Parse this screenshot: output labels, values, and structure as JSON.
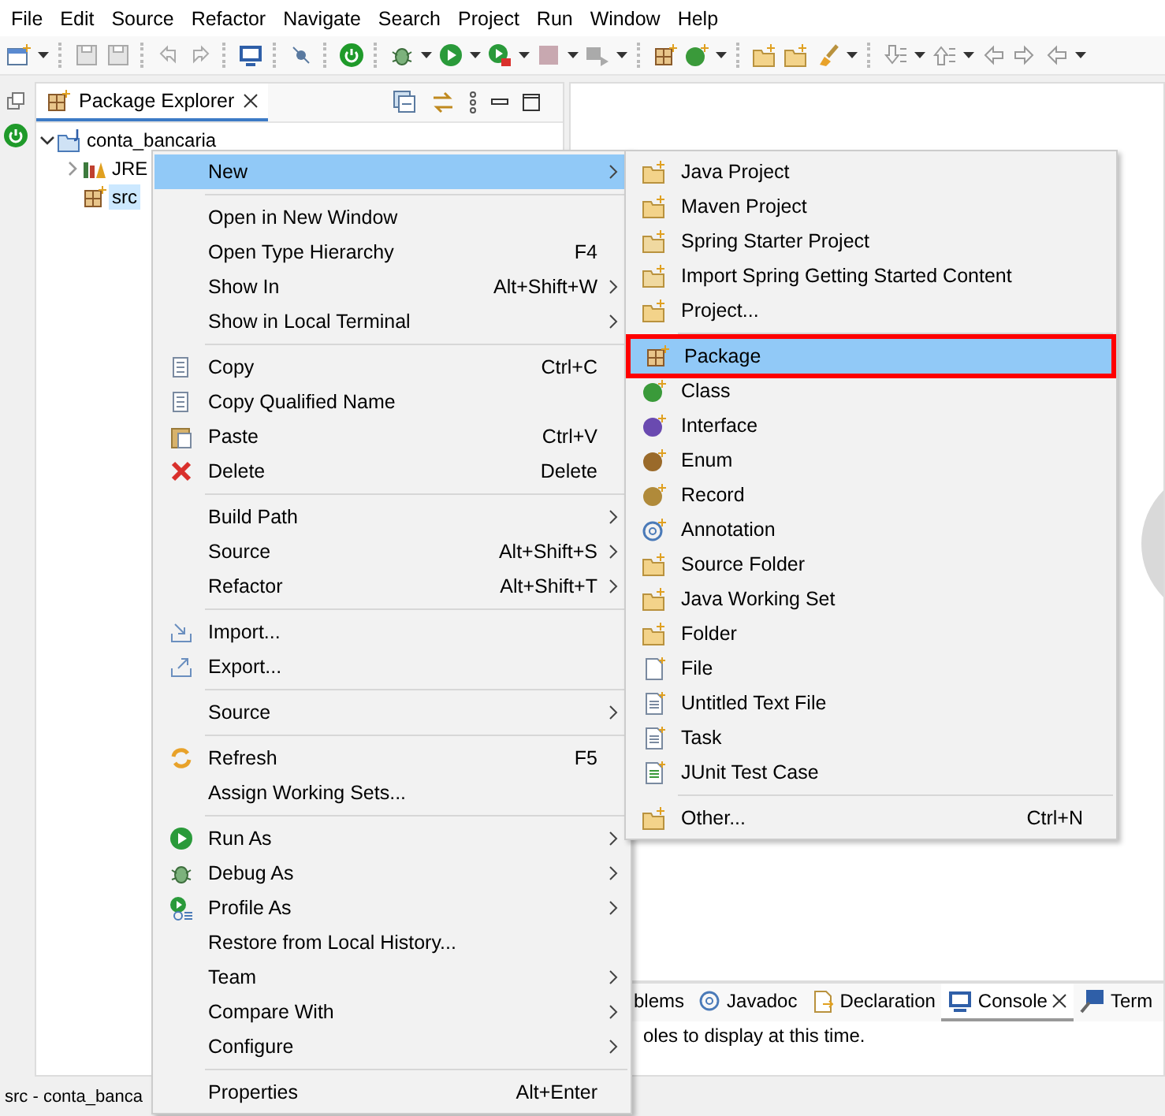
{
  "menu_bar": [
    "File",
    "Edit",
    "Source",
    "Refactor",
    "Navigate",
    "Search",
    "Project",
    "Run",
    "Window",
    "Help"
  ],
  "package_explorer": {
    "title": "Package Explorer",
    "tree": [
      {
        "label": "conta_bancaria",
        "kind": "project",
        "expanded": true,
        "selected": false,
        "children": [
          {
            "label": "JRE",
            "kind": "library",
            "expanded": false,
            "selected": false
          },
          {
            "label": "src",
            "kind": "source",
            "selected": true
          }
        ]
      }
    ]
  },
  "context_menu": {
    "groups": [
      [
        {
          "label": "New",
          "kind": "plain",
          "submenu": true,
          "selected": true
        }
      ],
      [
        {
          "label": "Open in New Window",
          "kind": "plain",
          "submenu": false,
          "selected": false
        },
        {
          "label": "Open Type Hierarchy",
          "kind": "plain",
          "shortcut": "F4",
          "submenu": false,
          "selected": false
        },
        {
          "label": "Show In",
          "kind": "plain",
          "shortcut": "Alt+Shift+W",
          "submenu": true,
          "selected": false
        },
        {
          "label": "Show in Local Terminal",
          "kind": "plain",
          "submenu": true,
          "selected": false
        }
      ],
      [
        {
          "label": "Copy",
          "kind": "copy",
          "shortcut": "Ctrl+C",
          "submenu": false,
          "selected": false
        },
        {
          "label": "Copy Qualified Name",
          "kind": "copy-name",
          "submenu": false,
          "selected": false
        },
        {
          "label": "Paste",
          "kind": "paste",
          "shortcut": "Ctrl+V",
          "submenu": false,
          "selected": false
        },
        {
          "label": "Delete",
          "kind": "delete",
          "shortcut": "Delete",
          "submenu": false,
          "selected": false
        }
      ],
      [
        {
          "label": "Build Path",
          "kind": "plain",
          "submenu": true,
          "selected": false
        },
        {
          "label": "Source",
          "kind": "plain",
          "shortcut": "Alt+Shift+S",
          "submenu": true,
          "selected": false
        },
        {
          "label": "Refactor",
          "kind": "plain",
          "shortcut": "Alt+Shift+T",
          "submenu": true,
          "selected": false
        }
      ],
      [
        {
          "label": "Import...",
          "kind": "import",
          "submenu": false,
          "selected": false
        },
        {
          "label": "Export...",
          "kind": "export",
          "submenu": false,
          "selected": false
        }
      ],
      [
        {
          "label": "Source",
          "kind": "plain",
          "submenu": true,
          "selected": false
        }
      ],
      [
        {
          "label": "Refresh",
          "kind": "refresh",
          "shortcut": "F5",
          "submenu": false,
          "selected": false
        },
        {
          "label": "Assign Working Sets...",
          "kind": "plain",
          "submenu": false,
          "selected": false
        }
      ],
      [
        {
          "label": "Run As",
          "kind": "run",
          "submenu": true,
          "selected": false
        },
        {
          "label": "Debug As",
          "kind": "debug",
          "submenu": true,
          "selected": false
        },
        {
          "label": "Profile As",
          "kind": "profile",
          "submenu": true,
          "selected": false
        },
        {
          "label": "Restore from Local History...",
          "kind": "plain",
          "submenu": false,
          "selected": false
        },
        {
          "label": "Team",
          "kind": "plain",
          "submenu": true,
          "selected": false
        },
        {
          "label": "Compare With",
          "kind": "plain",
          "submenu": true,
          "selected": false
        },
        {
          "label": "Configure",
          "kind": "plain",
          "submenu": true,
          "selected": false
        }
      ],
      [
        {
          "label": "Properties",
          "kind": "plain",
          "shortcut": "Alt+Enter",
          "submenu": false,
          "selected": false
        }
      ]
    ]
  },
  "new_submenu": {
    "groups": [
      [
        {
          "label": "Java Project",
          "kind": "java-project",
          "selected": false,
          "marked": false
        },
        {
          "label": "Maven Project",
          "kind": "maven-project",
          "selected": false,
          "marked": false
        },
        {
          "label": "Spring Starter Project",
          "kind": "spring",
          "selected": false,
          "marked": false
        },
        {
          "label": "Import Spring Getting Started Content",
          "kind": "spring",
          "selected": false,
          "marked": false
        },
        {
          "label": "Project...",
          "kind": "project",
          "selected": false,
          "marked": false
        }
      ],
      [
        {
          "label": "Package",
          "kind": "package",
          "selected": true,
          "marked": true
        },
        {
          "label": "Class",
          "kind": "class",
          "selected": false,
          "marked": false
        },
        {
          "label": "Interface",
          "kind": "interface",
          "selected": false,
          "marked": false
        },
        {
          "label": "Enum",
          "kind": "enum",
          "selected": false,
          "marked": false
        },
        {
          "label": "Record",
          "kind": "record",
          "selected": false,
          "marked": false
        },
        {
          "label": "Annotation",
          "kind": "annotation",
          "selected": false,
          "marked": false
        },
        {
          "label": "Source Folder",
          "kind": "source-folder",
          "selected": false,
          "marked": false
        },
        {
          "label": "Java Working Set",
          "kind": "working-set",
          "selected": false,
          "marked": false
        },
        {
          "label": "Folder",
          "kind": "folder",
          "selected": false,
          "marked": false
        },
        {
          "label": "File",
          "kind": "file",
          "selected": false,
          "marked": false
        },
        {
          "label": "Untitled Text File",
          "kind": "text-file",
          "selected": false,
          "marked": false
        },
        {
          "label": "Task",
          "kind": "task",
          "selected": false,
          "marked": false
        },
        {
          "label": "JUnit Test Case",
          "kind": "junit",
          "selected": false,
          "marked": false
        }
      ],
      [
        {
          "label": "Other...",
          "kind": "project",
          "shortcut": "Ctrl+N",
          "selected": false,
          "marked": false
        }
      ]
    ]
  },
  "bottom_panel": {
    "tabs": [
      {
        "label": "blems",
        "kind": "none",
        "selected": false
      },
      {
        "label": "Javadoc",
        "kind": "javadoc",
        "selected": false
      },
      {
        "label": "Declaration",
        "kind": "declaration",
        "selected": false
      },
      {
        "label": "Console",
        "kind": "console",
        "selected": true
      },
      {
        "label": "Term",
        "kind": "terminal",
        "selected": false
      }
    ],
    "message": "oles to display at this time."
  },
  "status_bar": {
    "text": "src - conta_banca"
  }
}
